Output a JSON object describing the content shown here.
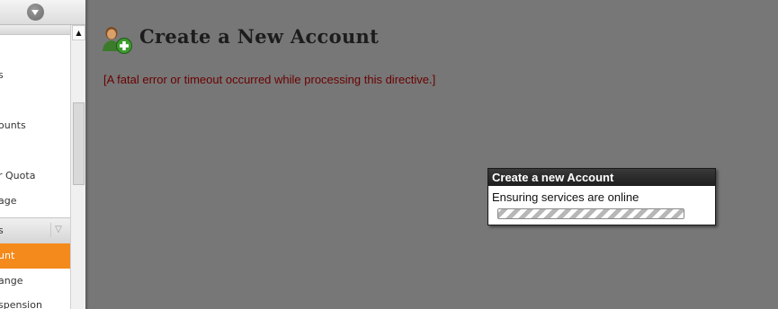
{
  "sidebar": {
    "items": [
      {
        "label": "s"
      },
      {
        "label": "ounts"
      },
      {
        "label": "r Quota"
      },
      {
        "label": "age"
      }
    ],
    "section_header": "s",
    "active_item": "unt",
    "after_items": [
      {
        "label": "ange"
      },
      {
        "label": "spension"
      }
    ]
  },
  "page": {
    "icon": "add-user-icon",
    "title": "Create a New Account",
    "error": "[A fatal error or timeout occurred while processing this directive.]"
  },
  "dialog": {
    "title": "Create a new Account",
    "message": "Ensuring services are online",
    "progress": 1.0
  },
  "colors": {
    "overlay_bg": "#777777",
    "active_item": "#f58a1c",
    "error_text": "#6a0000",
    "dialog_titlebar": "#2b2b2b"
  }
}
